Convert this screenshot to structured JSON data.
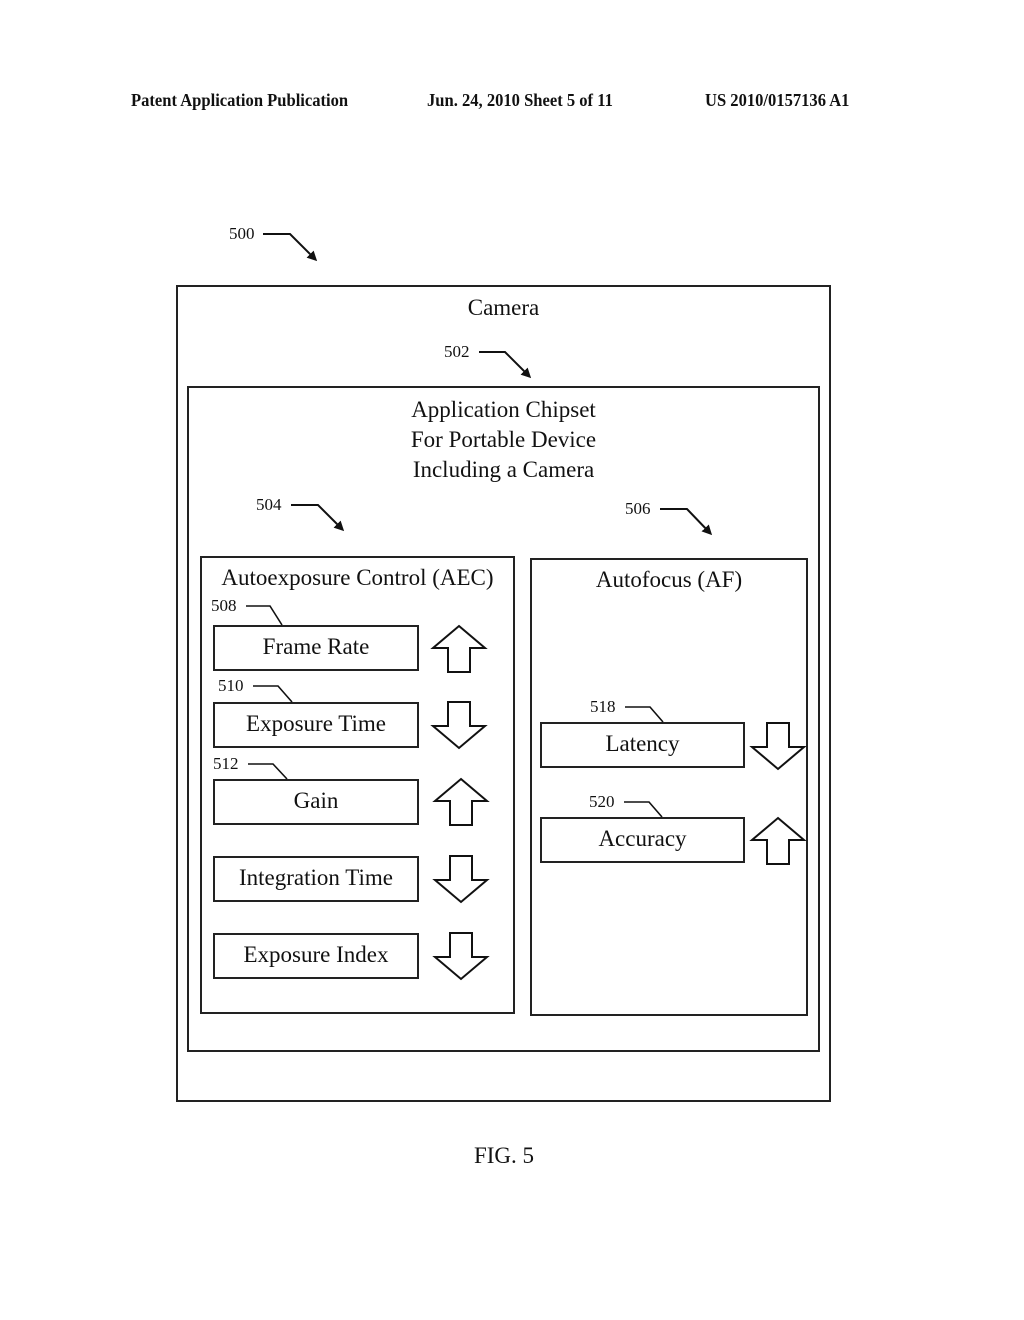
{
  "header": {
    "publication": "Patent Application Publication",
    "date_sheet": "Jun. 24, 2010  Sheet 5 of 11",
    "pub_number": "US 2010/0157136 A1"
  },
  "diagram": {
    "ref": "500",
    "camera": {
      "label": "Camera",
      "ref": "502"
    },
    "chipset": {
      "label_lines": [
        "Application Chipset",
        "For Portable Device",
        "Including a Camera"
      ]
    },
    "aec": {
      "ref": "504",
      "label": "Autoexposure Control (AEC)",
      "params": [
        {
          "label": "Frame Rate",
          "ref": "508",
          "direction": "up"
        },
        {
          "label": "Exposure Time",
          "ref": "510",
          "direction": "down"
        },
        {
          "label": "Gain",
          "ref": "512",
          "direction": "up"
        },
        {
          "label": "Integration Time",
          "ref": "",
          "direction": "down"
        },
        {
          "label": "Exposure Index",
          "ref": "",
          "direction": "down"
        }
      ]
    },
    "af": {
      "ref": "506",
      "label": "Autofocus (AF)",
      "params": [
        {
          "label": "Latency",
          "ref": "518",
          "direction": "down"
        },
        {
          "label": "Accuracy",
          "ref": "520",
          "direction": "up"
        }
      ]
    }
  },
  "figure_label": "FIG. 5"
}
